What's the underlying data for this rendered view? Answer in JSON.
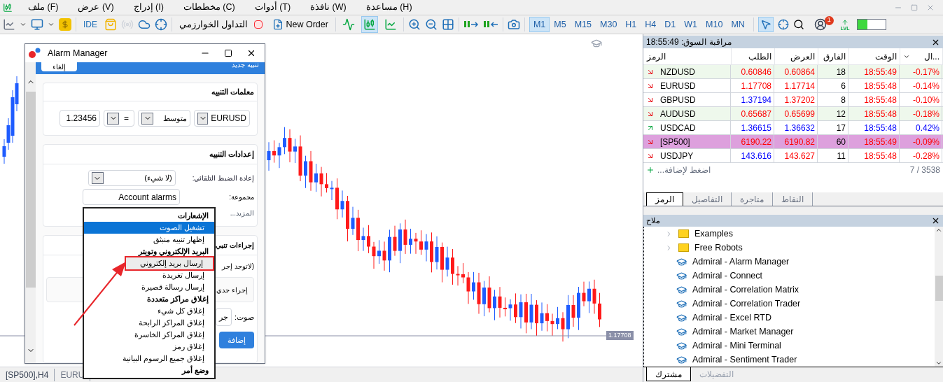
{
  "menu": [
    {
      "label": "مساعدة (H)"
    },
    {
      "label": "نافذة (W)"
    },
    {
      "label": "أدوات (T)"
    },
    {
      "label": "مخططات (C)"
    },
    {
      "label": "إدراج (I)"
    },
    {
      "label": "عرض (V)"
    },
    {
      "label": "ملف (F)"
    }
  ],
  "toolbar": {
    "ide": "IDE",
    "algo_trading": "التداول الخوارزمي",
    "new_order": "New Order",
    "chart_type": [
      {
        "kind": "bars",
        "selected": false
      },
      {
        "kind": "candles",
        "selected": true
      },
      {
        "kind": "line",
        "selected": false
      }
    ],
    "timeframes": [
      {
        "label": "MN",
        "selected": false
      },
      {
        "label": "M10",
        "selected": false
      },
      {
        "label": "W1",
        "selected": false
      },
      {
        "label": "D1",
        "selected": false
      },
      {
        "label": "H4",
        "selected": false
      },
      {
        "label": "H1",
        "selected": false
      },
      {
        "label": "M30",
        "selected": false
      },
      {
        "label": "M15",
        "selected": false
      },
      {
        "label": "M5",
        "selected": false
      },
      {
        "label": "M1",
        "selected": true
      }
    ],
    "cursor_selected": true,
    "notifications": "1",
    "lvl": "LVL",
    "level": 0.35
  },
  "chart": {
    "price_label": "1.17708",
    "tabs": [
      {
        "label": "EURU",
        "selected": false
      },
      {
        "label": "[SP500],H4",
        "selected": true
      }
    ]
  },
  "dialog": {
    "title": "Alarm Manager",
    "header_button": "إلغاء",
    "header_title": "تنبيه جديد",
    "params": {
      "title": "معلمات التنبيه",
      "symbol": "EURUSD",
      "mode": "متوسط",
      "operator": "=",
      "value": "1.23456"
    },
    "settings": {
      "title": "إعدادات التنبيه",
      "reset_label": "إعادة الضبط التلقائي:",
      "reset_value": "(لا شيء)",
      "group_label": "مجموعة:",
      "group_value": "Account alarms",
      "more": "المزيد..."
    },
    "actions": {
      "title": "إجراءات تنبي",
      "empty": "(لاتوجد إجر",
      "new_action": "إجراء جدي",
      "sound_label": "صوت:",
      "sound_value": "جر",
      "add": "إضافة"
    }
  },
  "dropdown": [
    {
      "kind": "header",
      "label": "الإشعارات"
    },
    {
      "kind": "item",
      "label": "تشغيل الصوت",
      "selected": true,
      "outlined": false
    },
    {
      "kind": "item",
      "label": "إظهار تنبيه منبثق",
      "selected": false,
      "outlined": false
    },
    {
      "kind": "header",
      "label": "البريد الإلكتروني وتويتر"
    },
    {
      "kind": "item",
      "label": "إرسال بريد إلكتروني",
      "selected": false,
      "outlined": true
    },
    {
      "kind": "item",
      "label": "إرسال تغريدة",
      "selected": false,
      "outlined": false
    },
    {
      "kind": "item",
      "label": "إرسال رسالة قصيرة",
      "selected": false,
      "outlined": false
    },
    {
      "kind": "header",
      "label": "إغلاق مراكز متعددة"
    },
    {
      "kind": "item",
      "label": "إغلاق كل شيء",
      "selected": false,
      "outlined": false
    },
    {
      "kind": "item",
      "label": "إغلاق المراكز الرابحة",
      "selected": false,
      "outlined": false
    },
    {
      "kind": "item",
      "label": "إغلاق المراكز الخاسرة",
      "selected": false,
      "outlined": false
    },
    {
      "kind": "item",
      "label": "إغلاق رمز",
      "selected": false,
      "outlined": false
    },
    {
      "kind": "item",
      "label": "إغلاق جميع الرسوم البيانية",
      "selected": false,
      "outlined": false
    },
    {
      "kind": "header",
      "label": "وضع أمر"
    }
  ],
  "market_watch": {
    "title": "مراقبة السوق: 18:55:49",
    "columns": [
      "...ال",
      "الوقت",
      "الفارق",
      "العرض",
      "الطلب",
      "الرمز"
    ],
    "rows": [
      {
        "symbol": "NZDUSD",
        "bid": "0.60846",
        "ask": "0.60864",
        "spread": "18",
        "time": "18:55:49",
        "change": "-0.17%",
        "rising": false,
        "bid_rising": false,
        "ask_rising": false,
        "highlighted": true,
        "selected": false
      },
      {
        "symbol": "EURUSD",
        "bid": "1.17708",
        "ask": "1.17714",
        "spread": "6",
        "time": "18:55:48",
        "change": "-0.14%",
        "rising": false,
        "bid_rising": false,
        "ask_rising": false,
        "highlighted": false,
        "selected": false
      },
      {
        "symbol": "GBPUSD",
        "bid": "1.37194",
        "ask": "1.37202",
        "spread": "8",
        "time": "18:55:48",
        "change": "-0.10%",
        "rising": false,
        "bid_rising": true,
        "ask_rising": false,
        "highlighted": false,
        "selected": false
      },
      {
        "symbol": "AUDUSD",
        "bid": "0.65687",
        "ask": "0.65699",
        "spread": "12",
        "time": "18:55:48",
        "change": "-0.18%",
        "rising": false,
        "bid_rising": false,
        "ask_rising": false,
        "highlighted": true,
        "selected": false
      },
      {
        "symbol": "USDCAD",
        "bid": "1.36615",
        "ask": "1.36632",
        "spread": "17",
        "time": "18:55:48",
        "change": "0.42%",
        "rising": true,
        "bid_rising": true,
        "ask_rising": true,
        "highlighted": false,
        "selected": false
      },
      {
        "symbol": "[SP500]",
        "bid": "6190.22",
        "ask": "6190.82",
        "spread": "60",
        "time": "18:55:49",
        "change": "-0.09%",
        "rising": false,
        "bid_rising": false,
        "ask_rising": false,
        "highlighted": false,
        "selected": true
      },
      {
        "symbol": "USDJPY",
        "bid": "143.616",
        "ask": "143.627",
        "spread": "11",
        "time": "18:55:48",
        "change": "-0.28%",
        "rising": false,
        "bid_rising": true,
        "ask_rising": false,
        "highlighted": false,
        "selected": false
      }
    ],
    "add": "اضغط لإضافة...",
    "count": "7 / 3538",
    "tabs": [
      {
        "label": "النقاط",
        "selected": false
      },
      {
        "label": "متاجرة",
        "selected": false
      },
      {
        "label": "التفاصيل",
        "selected": false
      },
      {
        "label": "الرمز",
        "selected": true
      }
    ]
  },
  "navigator": {
    "title": "ملاح",
    "items": [
      {
        "kind": "folder",
        "label": "Examples",
        "expanded": false
      },
      {
        "kind": "folder",
        "label": "Free Robots",
        "expanded": false
      },
      {
        "kind": "program",
        "label": "Admiral - Alarm Manager"
      },
      {
        "kind": "program",
        "label": "Admiral - Connect"
      },
      {
        "kind": "program",
        "label": "Admiral - Correlation Matrix"
      },
      {
        "kind": "program",
        "label": "Admiral - Correlation Trader"
      },
      {
        "kind": "program",
        "label": "Admiral - Excel RTD"
      },
      {
        "kind": "program",
        "label": "Admiral - Market Manager"
      },
      {
        "kind": "program",
        "label": "Admiral - Mini Terminal"
      },
      {
        "kind": "program",
        "label": "Admiral - Sentiment Trader"
      }
    ],
    "tabs": [
      {
        "label": "التفضيلات",
        "selected": false
      },
      {
        "label": "مشترك",
        "selected": true
      }
    ]
  }
}
